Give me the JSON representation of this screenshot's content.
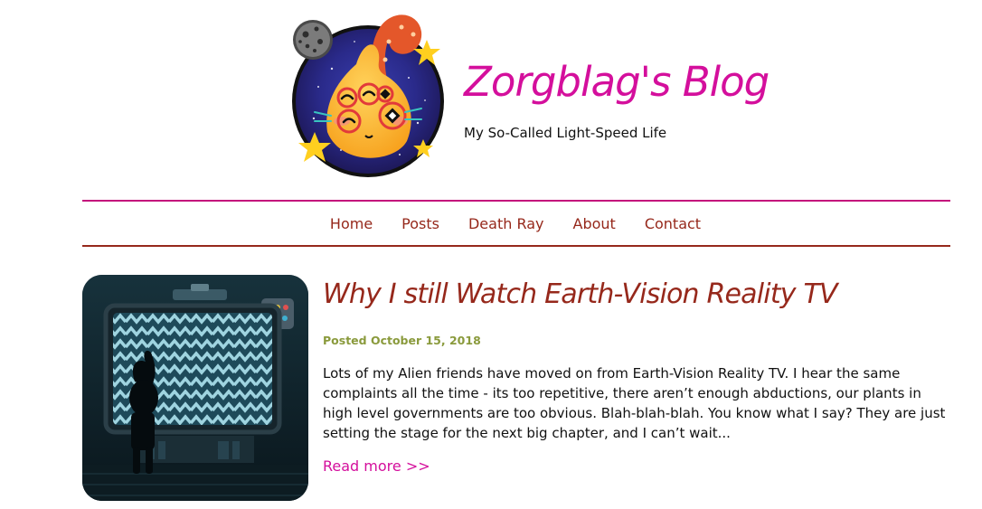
{
  "header": {
    "title": "Zorgblag's Blog",
    "tagline": "My So-Called Light-Speed Life",
    "logo_icon": "alien-blob-logo-icon"
  },
  "nav": {
    "items": [
      {
        "label": "Home"
      },
      {
        "label": "Posts"
      },
      {
        "label": "Death Ray"
      },
      {
        "label": "About"
      },
      {
        "label": "Contact"
      }
    ]
  },
  "post": {
    "title": "Why I still Watch Earth-Vision Reality TV",
    "date": "Posted October 15, 2018",
    "excerpt": "Lots of my Alien friends have moved on from Earth-Vision Reality TV. I hear the same complaints all the time - its too repetitive, there aren’t enough abductions, our plants in high level governments are too obvious. Blah-blah-blah. You know what I say? They are just setting the stage for the next big chapter, and I can’t wait...",
    "read_more": "Read more >>",
    "thumbnail_icon": "alien-watching-tv-thumbnail"
  },
  "colors": {
    "title_magenta": "#d40f9c",
    "nav_red": "#96281b",
    "date_olive": "#8a9a3c",
    "divider_top": "#c4127c"
  }
}
